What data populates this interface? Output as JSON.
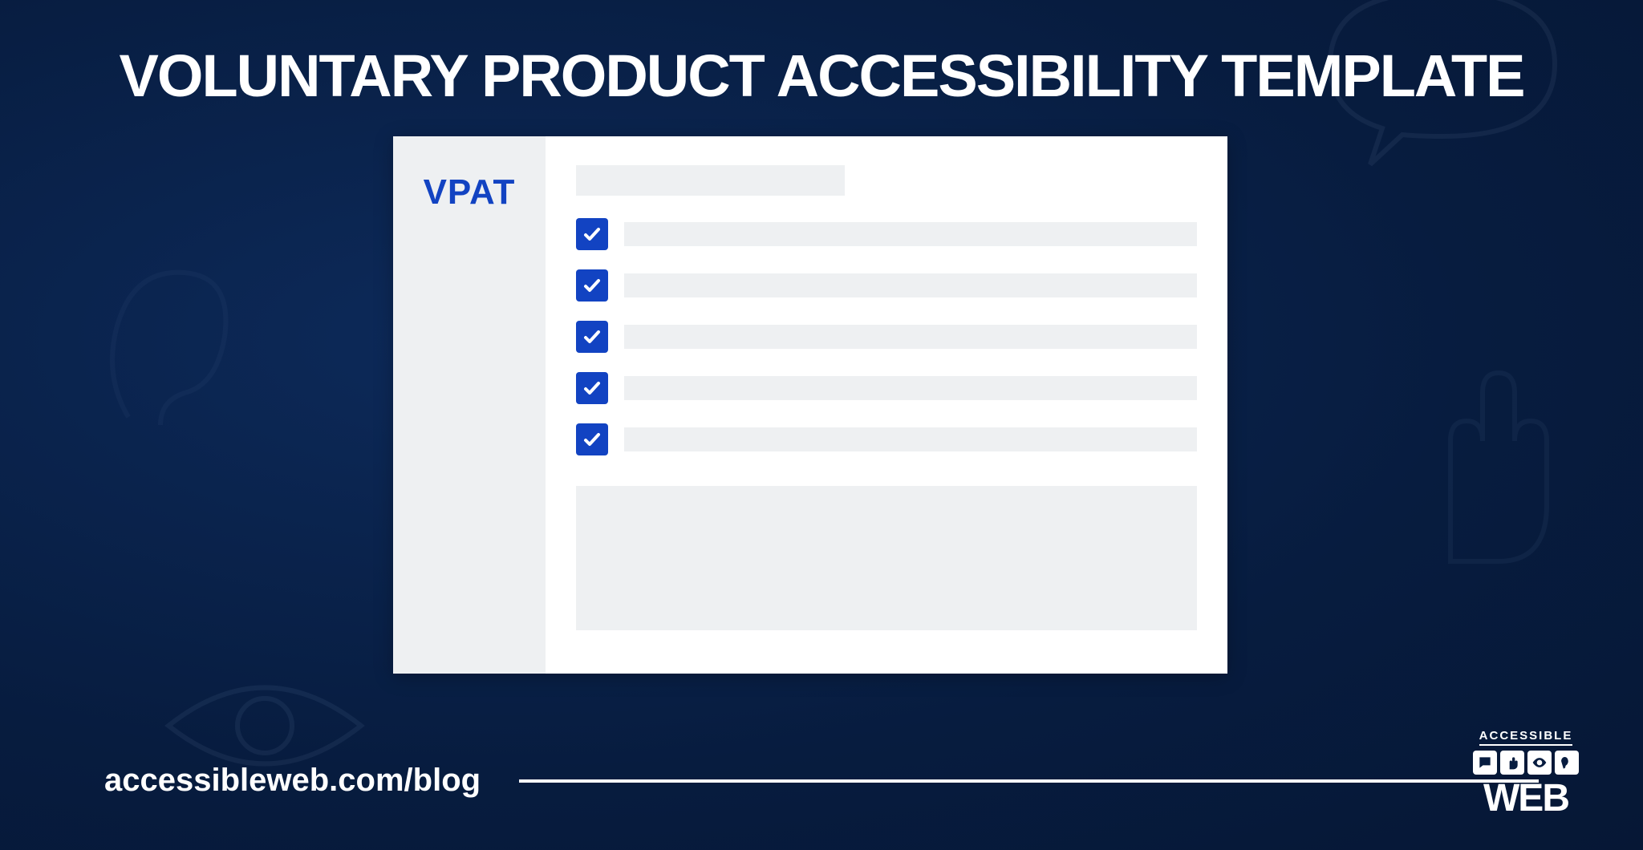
{
  "headline": "VOLUNTARY PRODUCT ACCESSIBILITY TEMPLATE",
  "document": {
    "sidebar_label": "VPAT",
    "checklist_rows": 5
  },
  "footer": {
    "url": "accessibleweb.com/blog"
  },
  "brand": {
    "top": "ACCESSIBLE",
    "word": "WEB"
  },
  "colors": {
    "background_dark": "#071c3f",
    "accent_blue": "#1243c2",
    "placeholder_gray": "#eef0f2"
  }
}
